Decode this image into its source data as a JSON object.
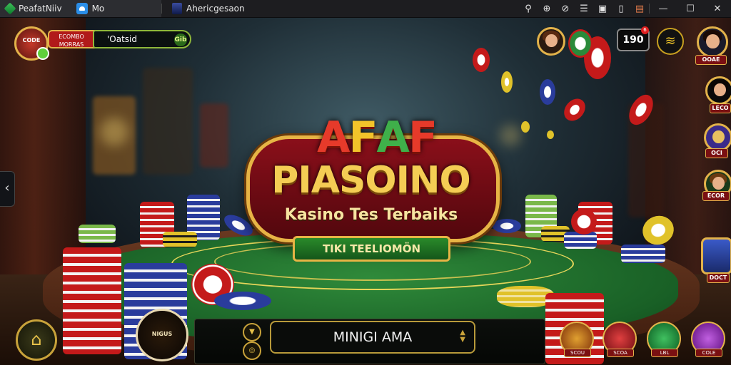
{
  "window": {
    "tab1_title": "PeafatNiiv",
    "tab2_title": "Mo",
    "tab3_title": "Ahericgesaon",
    "controls": [
      "minimize",
      "maximize",
      "close"
    ]
  },
  "hud": {
    "level_badge": "CODE",
    "player_name_line1": "ECOMBO",
    "player_name_line2": "MORRAS",
    "balance": "'Oatsid",
    "balance_add": "Gib",
    "counter": "190",
    "counter_badge": "6"
  },
  "logo": {
    "top": "AFAF",
    "main": "PIASOINO",
    "subtitle": "Kasino Tes Terbaiks",
    "ribbon": "TIKI TEELIOMÖN"
  },
  "side_panel": {
    "labels": [
      "OOAE",
      "LECO",
      "OCI",
      "ECOR",
      "DOCT"
    ]
  },
  "bottom": {
    "field_label": "MINIGI AMA",
    "emblem_text": "NIGUS",
    "shop_labels": [
      "SCOU",
      "SCOA",
      "LBL",
      "COLE"
    ]
  },
  "icons": {
    "home": "home-icon",
    "wifi": "wifi-icon",
    "back": "chevron-left-icon"
  },
  "colors": {
    "felt": "#196026",
    "gold": "#e2b24a",
    "logo_red": "#8a0f1a"
  }
}
